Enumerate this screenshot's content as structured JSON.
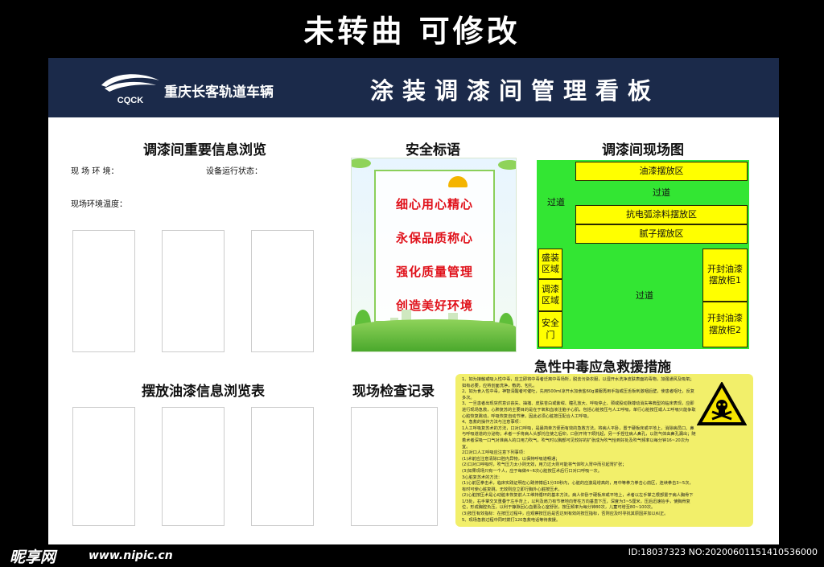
{
  "banner": "未转曲 可修改",
  "header": {
    "logo_text": "CQCK",
    "company": "重庆长客轨道车辆",
    "title": "涂装调漆间管理看板"
  },
  "info": {
    "title": "调漆间重要信息浏览",
    "env_label": "现 场 环 境：",
    "device_label": "设备运行状态：",
    "temp_label": "现场环境温度："
  },
  "safety": {
    "title": "安全标语",
    "slogans": [
      "细心用心精心",
      "永保品质称心",
      "强化质量管理",
      "创造美好环境"
    ]
  },
  "sitemap": {
    "title": "调漆间现场图",
    "zones": {
      "paint": "油漆摆放区",
      "aisle_top": "过道",
      "antistatic": "抗电弧涂料摆放区",
      "putty": "腻子摆放区",
      "aisle_left": "过道",
      "aisle_center": "过道",
      "container": "盛装区域",
      "mixing": "调漆区域",
      "exit": "安全门",
      "cabinet1": "开封油漆摆放柜1",
      "cabinet2": "开封油漆摆放柜2"
    }
  },
  "paint_table": {
    "title": "摆放油漆信息浏览表"
  },
  "inspection": {
    "title": "现场检查记录"
  },
  "emergency": {
    "title": "急性中毒应急救援措施",
    "lines": [
      "1、如为接触或吸入性中毒，应立即将中毒者迁离中毒场所，脱去污染衣服，以湿开水洗净皮肤表面的毒物，加强通风及吸氧；如有必要，应将创面洗净，敷药、包扎。",
      "2、如为食入性中毒，神智清醒者可催吐，先用500ml凉开水加食盐60g灌服再用手指或压舌板刺激咽后壁，使患者呕吐，反复多次。",
      "3、一旦患者出现突然意识丧失、抽搐、皮肤苍白或紫绀、瞳孔放大、呼吸停止、颈或股动脉搏动消失等典型的临床表现，应即进行现场急救，心肺复苏的主要目的是在于氧和血液注脑子心肌，包括心脏按压与人工呼吸，单行心脏按压或人工呼吸只能争取心脏恢复跳动，呼吸恢复自动节律，因此必须心脏按压配合人工呼吸。",
      "4、急救的操作方法与注意事项：",
      "1人工呼吸复苏术的方法，口对口呼吸，是最简单方便而有效的急救方法。将病人平卧，置于硬板床或平地上，消除病员口、鼻与呼吸道道的分泌物；术者一手将病人头部托住使之后仰，口张开将下颌托起，另一手捏住病人鼻孔，以防气体由鼻孔漏出；随着术者深吸一口气对准病人的口用力吹气，吹气时以胸部可见较好的扩张成为吹气恰到好处及吹气频率以每分钟16~20次为宜。",
      "2口对口人工呼吸应注意下列事项：",
      "(1)术前应注意清除口腔内异物，以保持呼吸道畅通；",
      "(2)口对口呼吸时，吹气压力太小则无效，用力过大则可能将气体吹入胃中而引起胃扩张；",
      "(3)如果现场只有一个人，应于每做4~6次心脏按压术后行口对口呼吸一次。",
      "3心脏复苏术的方法：",
      "(1)心前区拳击术，临床实践证明在心跳停搏后1分30秒内，心脏的应激是增高的，用中等拳力拳击心前区，连续拳击3~5次，有时可使心脏复跳，无效则应立即行胸外心脏按压术。",
      "(2)心脏按压术是心动脏未恢复前人工维持循环的基本方法。病人仰卧于硬板床或平地上，术者以左手掌之根部置于病人胸骨下1/3处，右手掌交叉重叠于左手背上，以利及肩力有节律地向脊柱方向垂直下压，深度为3~5厘米，压后迅速抬手，使胸骨复位，形成胸腔负压，以利于静脉回心血量及心室舒张，按压频率为每分钟80次，儿童可增至80~100次。",
      "(3)按压有效指标：在按压过程中，应观察按压后是否达到有效的按压指标，否则应及时寻找其原因并加以纠正。",
      "5、现场急救过程中同时拨打120急救电话等待救援。"
    ]
  },
  "footer": {
    "site_logo": "昵享网",
    "url": "www.nipic.cn",
    "id_text": "ID:18037323 NO:20200601151410536000"
  },
  "colors": {
    "header_bg": "#1b2a4a",
    "slogan_red": "#e0121b",
    "map_green": "#33e633",
    "map_yellow": "#ffff00",
    "emergency_bg": "#f2ef6a"
  }
}
